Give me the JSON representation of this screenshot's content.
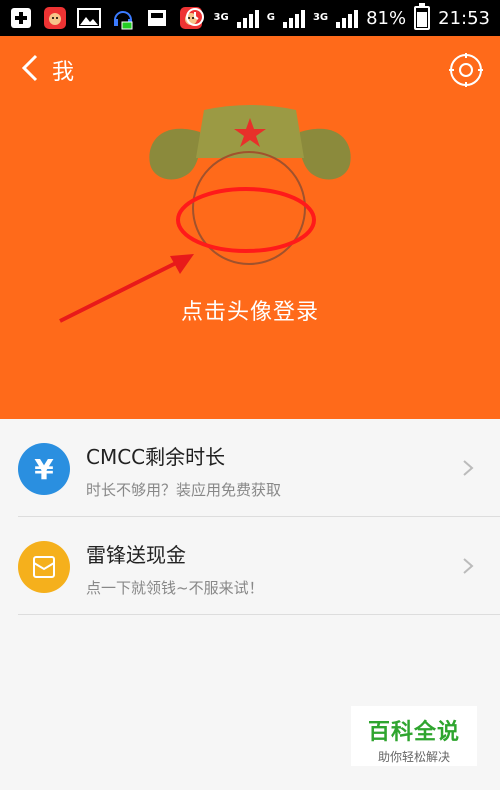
{
  "status_bar": {
    "network_1": "3G",
    "network_2": "G",
    "network_3": "3G",
    "battery": "81%",
    "time": "21:53",
    "icons": [
      "add-icon",
      "app-icon",
      "image-icon",
      "headset-icon",
      "inbox-icon",
      "app-icon",
      "alarm-icon",
      "signal-icon",
      "battery-icon"
    ]
  },
  "header": {
    "title": "我"
  },
  "hero": {
    "login_text": "点击头像登录",
    "accent_color": "#ff6a1a",
    "annotation_color": "#ff1a1a"
  },
  "list": {
    "items": [
      {
        "title": "CMCC剩余时长",
        "subtitle": "时长不够用？装应用免费获取",
        "icon": "yen-icon",
        "icon_symbol": "¥",
        "icon_color": "#2a8fe0"
      },
      {
        "title": "雷锋送现金",
        "subtitle": "点一下就领钱~不服来试！",
        "icon": "red-envelope-icon",
        "icon_color": "#f5b01c"
      }
    ]
  },
  "watermark": {
    "main": "百科全说",
    "sub": "助你轻松解决"
  }
}
